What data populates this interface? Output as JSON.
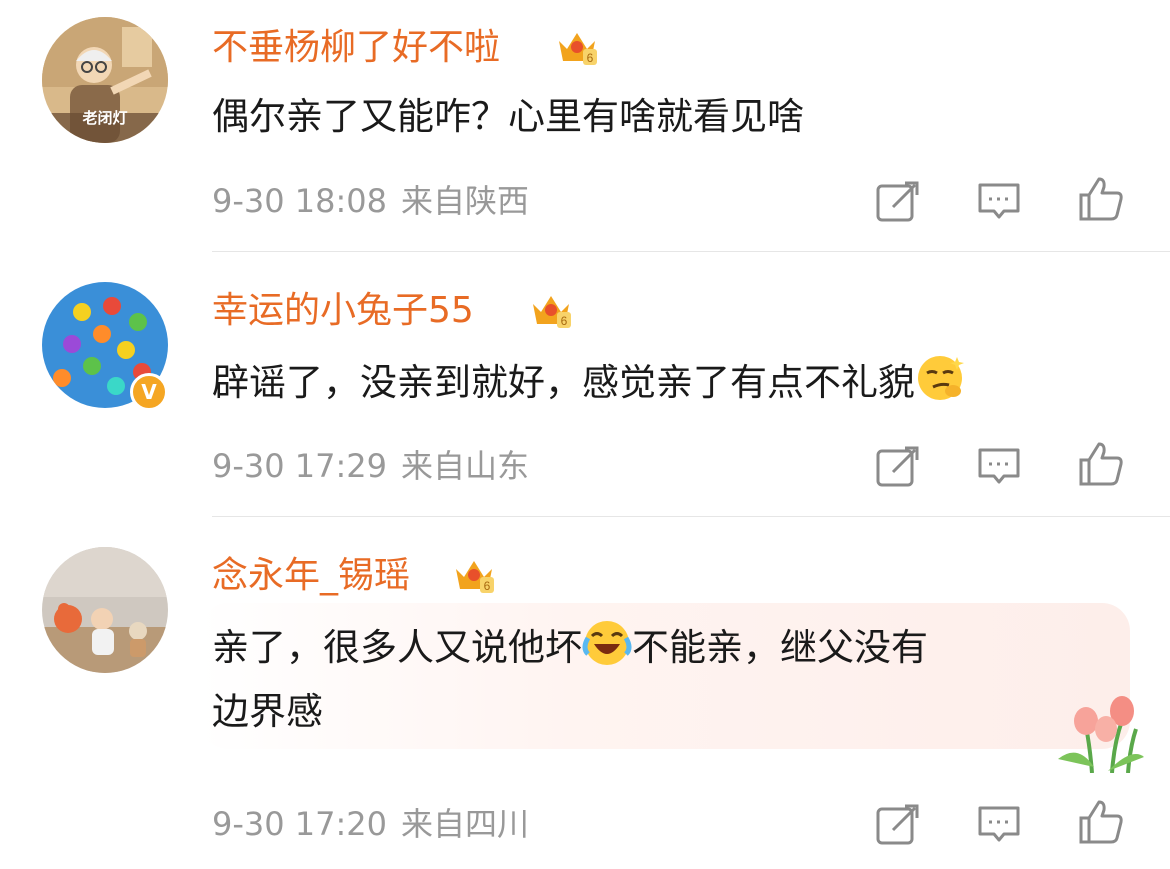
{
  "comments": [
    {
      "username": "不垂杨柳了好不啦",
      "avatar_caption": "老闭灯",
      "text": "偶尔亲了又能咋？心里有啥就看见啥",
      "date": "9-30 18:08",
      "location": "来自陕西",
      "crown_level": "6"
    },
    {
      "username": "幸运的小兔子55",
      "verified_badge": "V",
      "text": "辟谣了，没亲到就好，感觉亲了有点不礼貌",
      "emoji": "smirk-emoji",
      "date": "9-30 17:29",
      "location": "来自山东",
      "crown_level": "6"
    },
    {
      "username": "念永年_锡瑶",
      "text_line1_a": "亲了，很多人又说他坏",
      "emoji": "laugh-cry-emoji",
      "text_line1_b": "不能亲，继父没有",
      "text_line2": "边界感",
      "date": "9-30 17:20",
      "location": "来自四川",
      "crown_level": "6"
    }
  ],
  "colors": {
    "username": "#e86b25",
    "meta": "#999999",
    "text": "#1a1a1a",
    "crown": "#f2a31d",
    "verified": "#f5a623"
  },
  "icons": [
    "share-icon",
    "comment-icon",
    "like-icon",
    "crown-icon",
    "tulip-decoration"
  ]
}
